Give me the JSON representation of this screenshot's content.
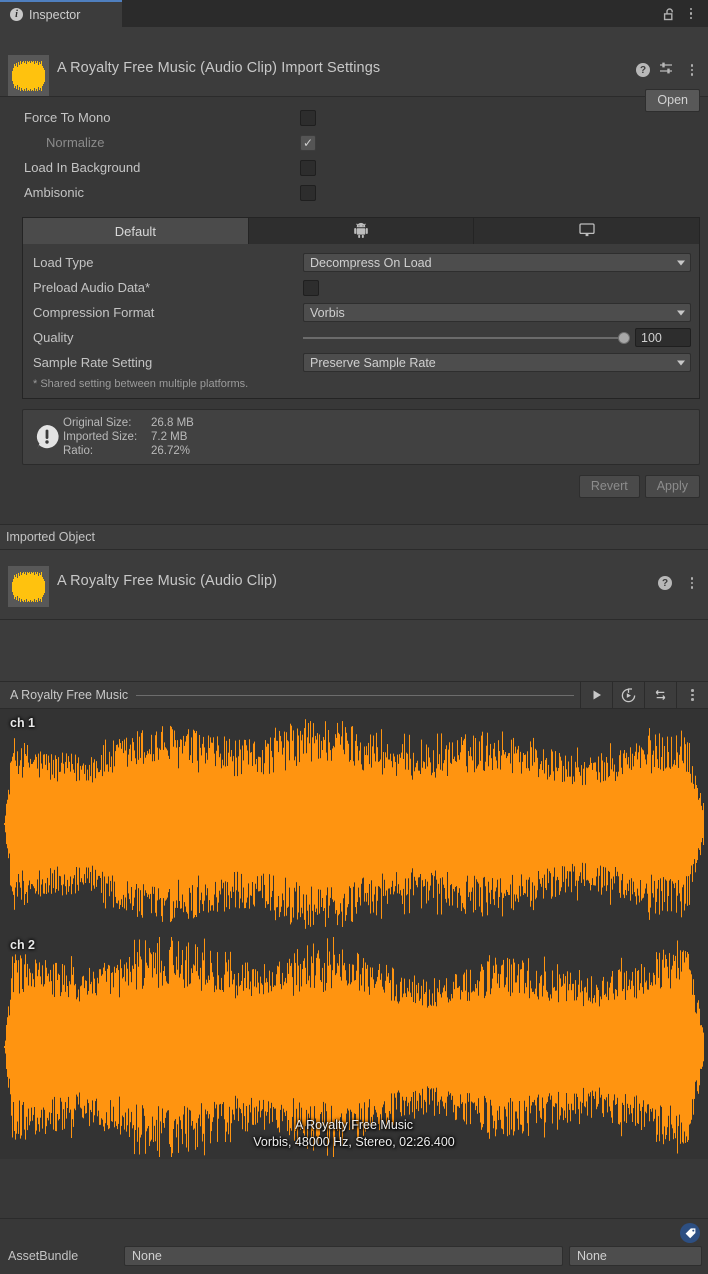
{
  "window": {
    "tab_label": "Inspector",
    "tab_icon": "info-icon",
    "lock_icon": "unlock-icon",
    "menu_icon": "kebab-menu-icon"
  },
  "asset_header": {
    "title": "A Royalty Free Music (Audio Clip) Import Settings",
    "thumbnail_icon": "audio-waveform-thumbnail",
    "help_icon": "help-icon",
    "preset_icon": "preset-sliders-icon",
    "menu_icon": "kebab-menu-icon",
    "open_button": "Open"
  },
  "top_properties": [
    {
      "label": "Force To Mono",
      "checked": false,
      "disabled": false
    },
    {
      "label": "Normalize",
      "checked": true,
      "disabled": true,
      "indent": true
    },
    {
      "label": "Load In Background",
      "checked": false,
      "disabled": false
    },
    {
      "label": "Ambisonic",
      "checked": false,
      "disabled": false
    }
  ],
  "platform_tabs": [
    {
      "label": "Default",
      "icon": "",
      "active": true
    },
    {
      "label": "",
      "icon": "android-icon",
      "active": false
    },
    {
      "label": "",
      "icon": "desktop-monitor-icon",
      "active": false
    }
  ],
  "platform_settings": {
    "load_type": {
      "label": "Load Type",
      "value": "Decompress On Load"
    },
    "preload_audio_data": {
      "label": "Preload Audio Data*",
      "checked": false
    },
    "compression_format": {
      "label": "Compression Format",
      "value": "Vorbis"
    },
    "quality": {
      "label": "Quality",
      "value": "100",
      "percent": 100
    },
    "sample_rate_setting": {
      "label": "Sample Rate Setting",
      "value": "Preserve Sample Rate"
    },
    "footnote": "* Shared setting between multiple platforms."
  },
  "info_box": {
    "icon": "warning-speech-bubble-icon",
    "rows": [
      {
        "key": "Original Size:",
        "value": "26.8 MB"
      },
      {
        "key": "Imported Size:",
        "value": "7.2 MB"
      },
      {
        "key": "Ratio:",
        "value": "26.72%"
      }
    ]
  },
  "action_buttons": {
    "revert": "Revert",
    "apply": "Apply"
  },
  "imported_object": {
    "section_label": "Imported Object",
    "title": "A Royalty Free Music (Audio Clip)",
    "thumbnail_icon": "audio-waveform-thumbnail",
    "help_icon": "help-icon",
    "menu_icon": "kebab-menu-icon"
  },
  "audio_preview": {
    "clip_name": "A Royalty Free Music",
    "play_icon": "play-icon",
    "restart_icon": "restart-playback-icon",
    "loop_icon": "loop-icon",
    "menu_icon": "kebab-menu-icon",
    "channel_1_label": "ch 1",
    "channel_2_label": "ch 2",
    "caption_title": "A Royalty Free Music",
    "caption_details": "Vorbis, 48000 Hz, Stereo, 02:26.400",
    "waveform_color": "#FF9410"
  },
  "asset_bundle": {
    "tag_icon": "asset-label-tag-icon",
    "label": "AssetBundle",
    "name_value": "None",
    "variant_value": "None"
  }
}
